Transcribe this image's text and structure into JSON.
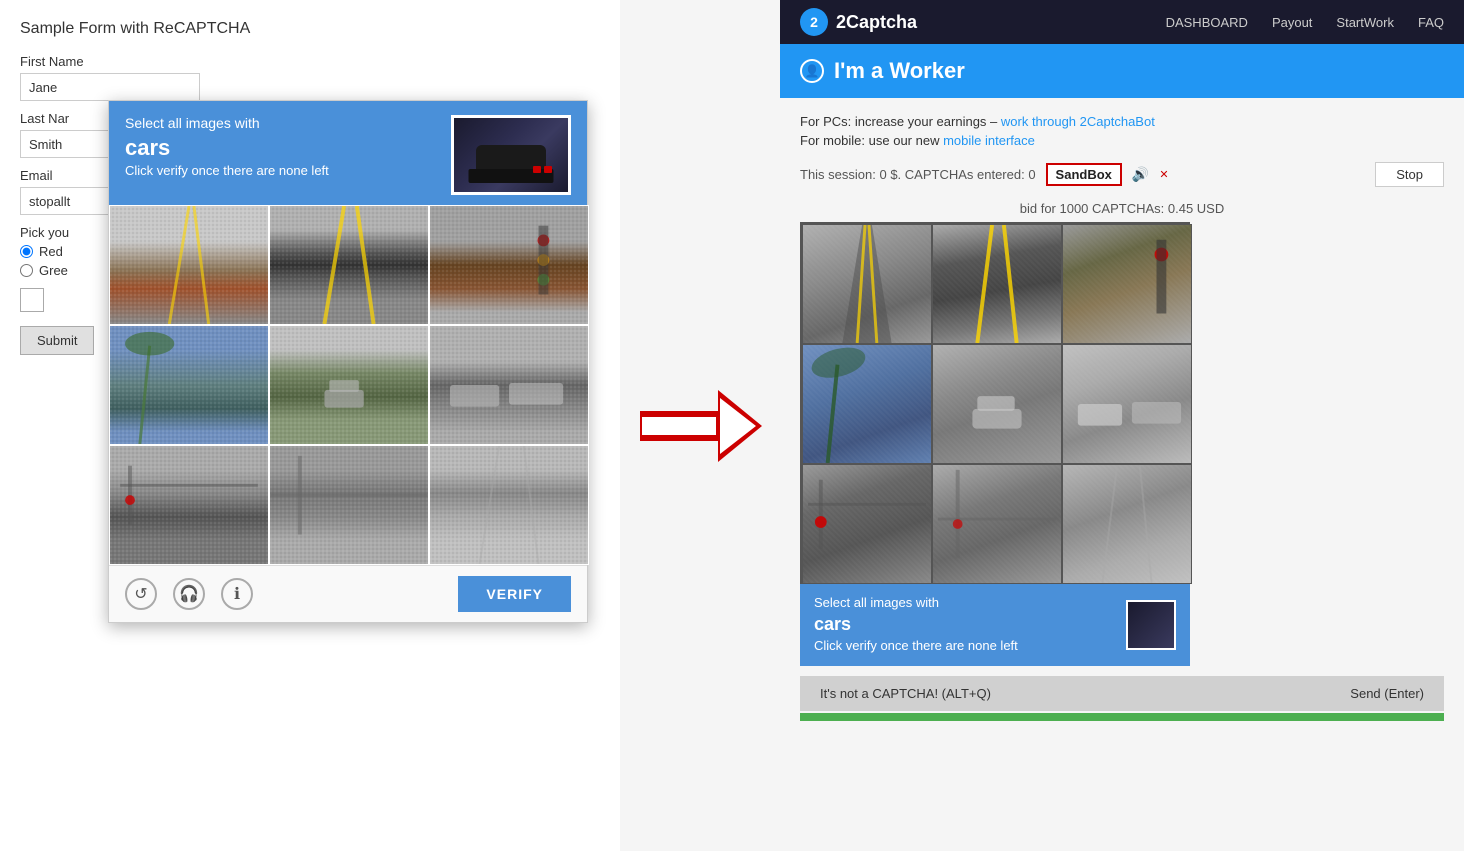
{
  "form": {
    "title": "Sample Form with ReCAPTCHA",
    "first_name_label": "First Name",
    "first_name_value": "Jane",
    "last_name_label": "Last Nar",
    "last_name_value": "Smith",
    "email_label": "Email",
    "email_placeholder": "stopallt",
    "pick_label": "Pick you",
    "radio1": "Red",
    "radio2": "Gree",
    "submit_label": "Submit"
  },
  "recaptcha": {
    "header_prefix": "Select all images with",
    "header_bold": "cars",
    "header_sub": "Click verify once there are none left",
    "verify_label": "VERIFY"
  },
  "arrow": {},
  "nav": {
    "logo_text": "2Captcha",
    "links": [
      "DASHBOARD",
      "Payout",
      "StartWork",
      "FAQ"
    ]
  },
  "worker": {
    "title": "I'm a Worker"
  },
  "info": {
    "pc_prefix": "For PCs: ",
    "pc_text": "increase your earnings –",
    "pc_link": "work through 2CaptchaBot",
    "mobile_prefix": "For mobile: ",
    "mobile_text": "use our new",
    "mobile_link": "mobile interface"
  },
  "session": {
    "prefix": "This session: 0 $. CAPTCHAs entered: 0",
    "sandbox_label": "SandBox",
    "stop_label": "Stop"
  },
  "bid": {
    "text": "bid for 1000 CAPTCHAs: 0.45 USD"
  },
  "action_bar": {
    "left_label": "It's not a CAPTCHA! (ALT+Q)",
    "right_label": "Send (Enter)"
  }
}
